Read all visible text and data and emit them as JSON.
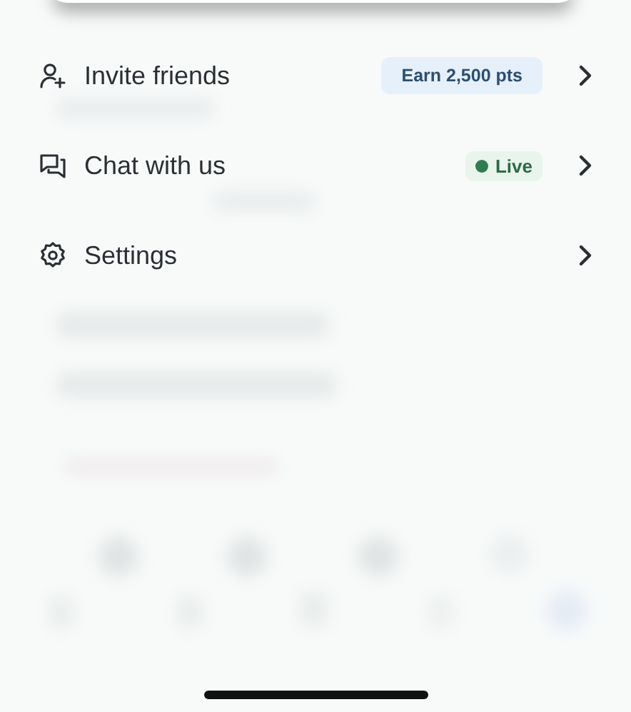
{
  "menu": {
    "items": [
      {
        "label": "Invite friends",
        "kind": "invite",
        "badge": {
          "kind": "info",
          "text": "Earn 2,500 pts"
        }
      },
      {
        "label": "Chat with us",
        "kind": "chat",
        "badge": {
          "kind": "live",
          "text": "Live"
        }
      },
      {
        "label": "Settings",
        "kind": "settings"
      }
    ]
  }
}
